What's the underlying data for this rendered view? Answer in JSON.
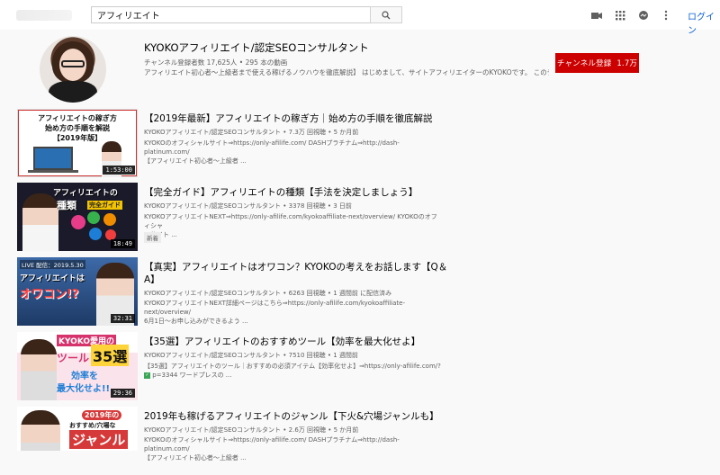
{
  "search": {
    "query": "アフィリエイト"
  },
  "header": {
    "login_label": "ログイン"
  },
  "channel": {
    "name": "KYOKOアフィリエイト/認定SEOコンサルタント",
    "stats": "チャンネル登録者数 17,625人 • 295 本の動画",
    "description": "アフィリエイト初心者～上級者まで使える稼げるノウハウを徹底解説】 はじめまして、サイトアフィリエイターのKYOKOです。 このチャンネル...",
    "subscribe_label": "チャンネル登録",
    "subscriber_count": "1.7万"
  },
  "videos": [
    {
      "title": "【2019年最新】アフィリエイトの稼ぎ方｜始め方の手順を徹底解説",
      "meta": "KYOKOアフィリエイト/認定SEOコンサルタント • 7.3万 回視聴 • 5 か月前",
      "desc1": "KYOKOのオフィシャルサイト⇒https://only-afilife.com/ DASHプラチナム⇒http://dash-platinum.com/",
      "desc2": "【アフィリエイト初心者～上級者 ...",
      "duration": "1:53:00",
      "thumb_text": [
        "アフィリエイトの稼ぎ方",
        "始め方の手順を解説",
        "【2019年版】"
      ]
    },
    {
      "title": "【完全ガイド】アフィリエイトの種類【手法を決定しましょう】",
      "meta": "KYOKOアフィリエイト/認定SEOコンサルタント • 3378 回視聴 • 3 日前",
      "desc1": "KYOKOアフィリエイトNEXT⇒https://only-afilife.com/kyokoaffiliate-next/overview/ KYOKOのオフィシャ",
      "desc2": "ルサイト ...",
      "badge": "新着",
      "duration": "18:49",
      "thumb_text": [
        "アフィリエイトの",
        "種類",
        "完全ガイド"
      ]
    },
    {
      "title": "【真実】アフィリエイトはオワコン？KYOKOの考えをお話します【Q＆A】",
      "meta": "KYOKOアフィリエイト/認定SEOコンサルタント • 6263 回視聴 • 1 週間前 に配信済み",
      "desc1": "KYOKOアフィリエイトNEXT詳細ページはこちら⇒https://only-afilife.com/kyokoaffiliate-next/overview/",
      "desc2": "6月1日～お申し込みができるよう ...",
      "duration": "32:31",
      "thumb_text": [
        "LIVE 配信：2019.5.30",
        "アフィリエイトは",
        "オワコン!?"
      ]
    },
    {
      "title": "【35選】アフィリエイトのおすすめツール【効率を最大化せよ】",
      "meta": "KYOKOアフィリエイト/認定SEOコンサルタント • 7510 回視聴 • 1 週間前",
      "desc1": "【35選】アフィリエイトのツール｜おすすめの必須アイテム【効率化せよ】⇒https://only-afilife.com/?",
      "desc2": "p=3344 ワードプレスの ...",
      "duration": "29:36",
      "thumb_text": [
        "KYOKO愛用の",
        "ツール",
        "35選",
        "効率を",
        "最大化せよ!!"
      ]
    },
    {
      "title": "2019年も稼げるアフィリエイトのジャンル【下火&穴場ジャンルも】",
      "meta": "KYOKOアフィリエイト/認定SEOコンサルタント • 2.6万 回視聴 • 5 か月前",
      "desc1": "KYOKOのオフィシャルサイト⇒https://only-afilife.com/ DASHプラチナム⇒http://dash-platinum.com/",
      "desc2": "【アフィリエイト初心者～上級者 ...",
      "thumb_text": [
        "2019年の",
        "おすすめ/穴場な",
        "ジャンル"
      ]
    }
  ],
  "colors": {
    "accent_red": "#cc0000",
    "link_blue": "#065fd4"
  }
}
